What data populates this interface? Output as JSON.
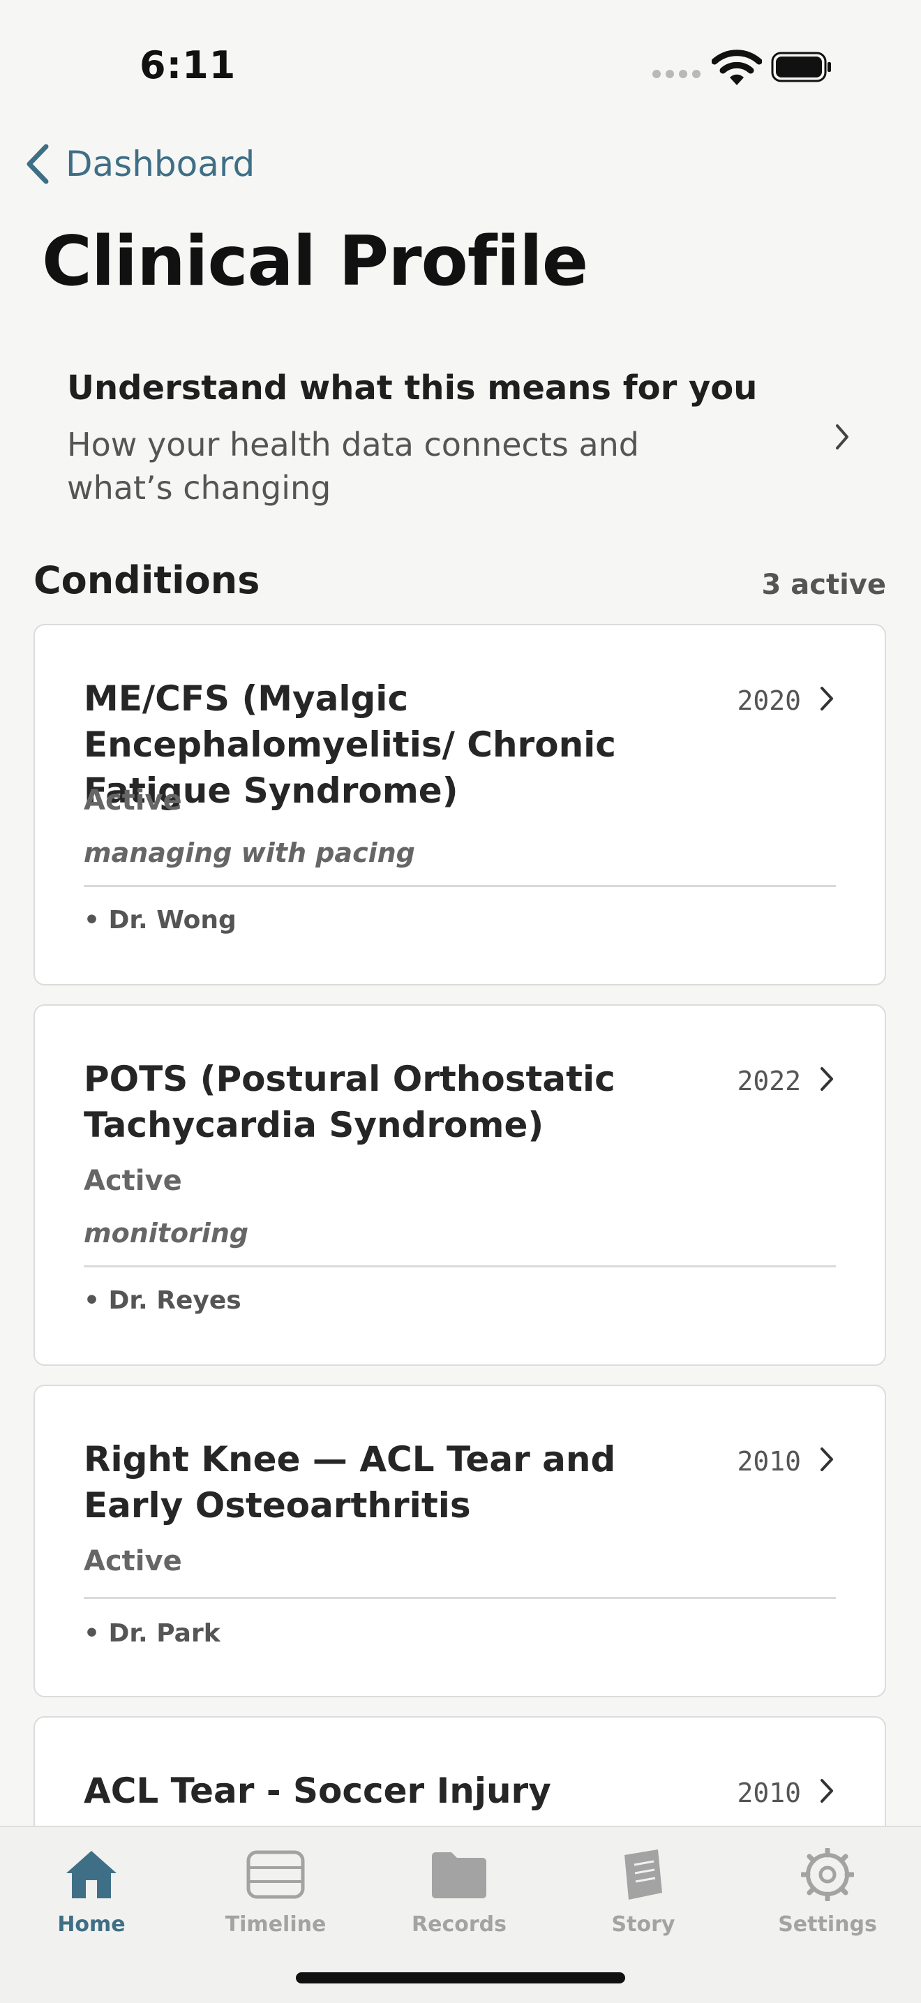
{
  "status_bar": {
    "time": "6:11"
  },
  "nav": {
    "back_label": "Dashboard",
    "title": "Clinical Profile"
  },
  "insight": {
    "title": "Understand what this means for you",
    "subtitle": "How your health data connects and what’s changing"
  },
  "conditions": {
    "title": "Conditions",
    "count": "3 active",
    "items": [
      {
        "name": "ME/CFS (Myalgic Encephalomyelitis/ Chronic Fatigue Syndrome)",
        "year": "2020",
        "status": "Active",
        "note": "managing with pacing",
        "doctor": "• Dr. Wong"
      },
      {
        "name": "POTS (Postural Orthostatic Tachycardia Syndrome)",
        "year": "2022",
        "status": "Active",
        "note": "monitoring",
        "doctor": "• Dr. Reyes"
      },
      {
        "name": "Right Knee — ACL Tear and Early Osteoarthritis",
        "year": "2010",
        "status": "Active",
        "doctor": "• Dr. Park"
      },
      {
        "name": "ACL Tear - Soccer Injury",
        "year": "2010"
      }
    ]
  },
  "tabs": [
    {
      "label": "Home",
      "icon": "house-icon",
      "active": true
    },
    {
      "label": "Timeline",
      "icon": "timeline-icon"
    },
    {
      "label": "Records",
      "icon": "folder-icon"
    },
    {
      "label": "Story",
      "icon": "book-icon"
    },
    {
      "label": "Settings",
      "icon": "gear-icon"
    }
  ],
  "colors": {
    "accent": "#3f6f87",
    "inactive": "#a3a3a3",
    "background": "#f6f6f4"
  }
}
